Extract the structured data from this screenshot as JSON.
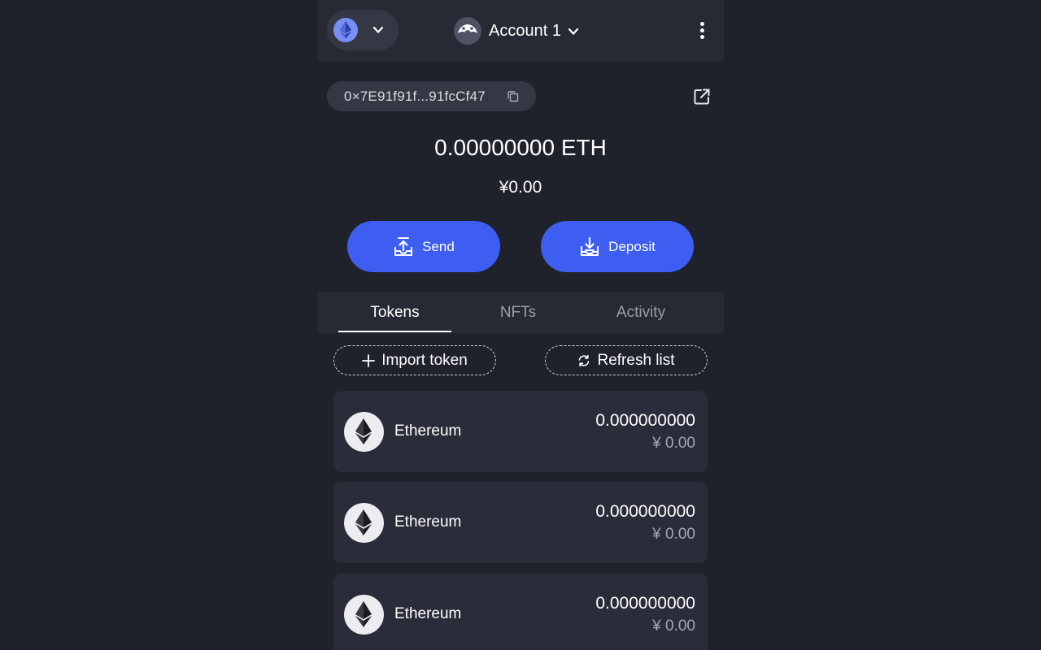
{
  "header": {
    "network_icon": "ethereum-diamond-icon",
    "account_name": "Account 1",
    "menu_icon": "more-vertical-icon"
  },
  "wallet": {
    "address": "0×7E91f91f...91fcCf47",
    "balance_eth": "0.00000000 ETH",
    "balance_fiat": "¥0.00"
  },
  "actions": {
    "send_label": "Send",
    "deposit_label": "Deposit"
  },
  "tabs": [
    {
      "label": "Tokens",
      "active": true
    },
    {
      "label": "NFTs",
      "active": false
    },
    {
      "label": "Activity",
      "active": false
    }
  ],
  "token_actions": {
    "import_label": "Import token",
    "refresh_label": "Refresh list"
  },
  "tokens": [
    {
      "name": "Ethereum",
      "amount": "0.000000000",
      "fiat": "¥ 0.00"
    },
    {
      "name": "Ethereum",
      "amount": "0.000000000",
      "fiat": "¥ 0.00"
    },
    {
      "name": "Ethereum",
      "amount": "0.000000000",
      "fiat": "¥ 0.00"
    }
  ],
  "colors": {
    "background": "#1f222b",
    "topbar": "#272a34",
    "accent": "#3d5ef0",
    "card": "#2a2d39"
  }
}
